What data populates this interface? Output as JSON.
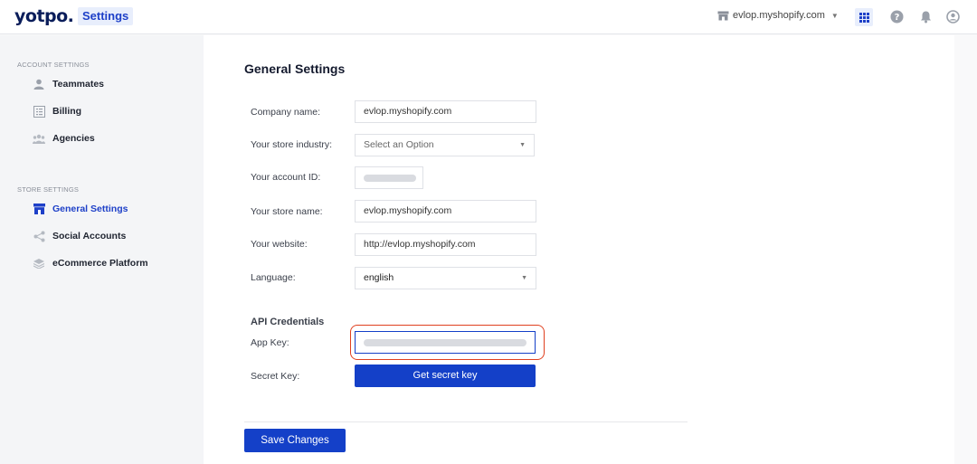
{
  "header": {
    "logo": "yotpo.",
    "section": "Settings",
    "store": "evlop.myshopify.com"
  },
  "sidebar": {
    "account_heading": "ACCOUNT SETTINGS",
    "account_items": [
      {
        "label": "Teammates",
        "icon": "person-icon"
      },
      {
        "label": "Billing",
        "icon": "invoice-icon"
      },
      {
        "label": "Agencies",
        "icon": "group-icon"
      }
    ],
    "store_heading": "STORE SETTINGS",
    "store_items": [
      {
        "label": "General Settings",
        "icon": "storefront-icon",
        "active": true
      },
      {
        "label": "Social Accounts",
        "icon": "share-icon"
      },
      {
        "label": "eCommerce Platform",
        "icon": "layers-icon"
      }
    ]
  },
  "main": {
    "title": "General Settings",
    "fields": {
      "company_label": "Company name:",
      "company_value": "evlop.myshopify.com",
      "industry_label": "Your store industry:",
      "industry_placeholder": "Select an Option",
      "account_id_label": "Your account ID:",
      "store_name_label": "Your store name:",
      "store_name_value": "evlop.myshopify.com",
      "website_label": "Your website:",
      "website_value": "http://evlop.myshopify.com",
      "language_label": "Language:",
      "language_value": "english"
    },
    "api": {
      "heading": "API Credentials",
      "app_key_label": "App Key:",
      "secret_key_label": "Secret Key:",
      "secret_button": "Get secret key"
    },
    "save_button": "Save Changes"
  },
  "colors": {
    "brand_blue": "#1440c8",
    "logo_navy": "#0a1d5a",
    "highlight_red": "#e0401f"
  }
}
